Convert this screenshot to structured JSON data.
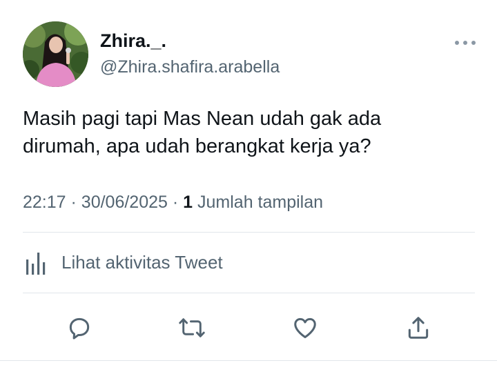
{
  "user": {
    "display_name": "Zhira._.",
    "handle": "@Zhira.shafira.arabella",
    "avatar_icon": "profile-photo"
  },
  "tweet": {
    "text_lines": [
      "Masih pagi tapi Mas Nean udah gak ada",
      "dirumah, apa udah berangkat kerja ya?"
    ],
    "time": "22:17",
    "separator": "·",
    "date": "30/06/2025",
    "views_count": "1",
    "views_label": "Jumlah tampilan"
  },
  "activity": {
    "label": "Lihat aktivitas Tweet",
    "icon": "analytics-bars-icon"
  },
  "actions": {
    "reply_icon": "reply-icon",
    "retweet_icon": "retweet-icon",
    "like_icon": "heart-icon",
    "share_icon": "share-icon"
  },
  "colors": {
    "text_primary": "#0f1419",
    "text_secondary": "#536471",
    "divider": "#e1e6ea"
  }
}
